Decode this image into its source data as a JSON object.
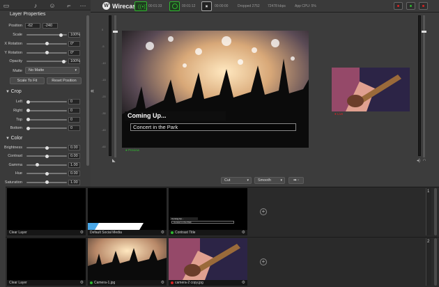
{
  "app": {
    "title": "Wirecast"
  },
  "left_panel": {
    "title": "Layer Properties",
    "tab_icons": [
      "monitor-icon",
      "speaker-icon",
      "user-icon",
      "crop-icon",
      "more-icon"
    ],
    "position": {
      "label": "Position",
      "x": "-62",
      "y": "-240"
    },
    "sliders": [
      {
        "label": "Scale",
        "value": "100%",
        "level": 0.88
      },
      {
        "label": "X Rotation",
        "value": "0°",
        "level": 0.5
      },
      {
        "label": "Y Rotation",
        "value": "0°",
        "level": 0.5
      },
      {
        "label": "Opacity",
        "value": "100%",
        "level": 0.97
      }
    ],
    "matte": {
      "label": "Matte",
      "value": "No Matte"
    },
    "buttons": {
      "scale_to_fit": "Scale To Fit",
      "reset_position": "Reset Position"
    },
    "crop": {
      "title": "Crop",
      "sliders": [
        {
          "label": "Left",
          "value": "0",
          "level": 0.0
        },
        {
          "label": "Right",
          "value": "0",
          "level": 0.0
        },
        {
          "label": "Top",
          "value": "0",
          "level": 0.0
        },
        {
          "label": "Bottom",
          "value": "0",
          "level": 0.0
        }
      ]
    },
    "color": {
      "title": "Color",
      "sliders": [
        {
          "label": "Brightness",
          "value": "0.00",
          "level": 0.5
        },
        {
          "label": "Contrast",
          "value": "0.00",
          "level": 0.5
        },
        {
          "label": "Gamma",
          "value": "1.00",
          "level": 0.25
        },
        {
          "label": "Hue",
          "value": "0.00",
          "level": 0.5
        },
        {
          "label": "Saturation",
          "value": "1.00",
          "level": 0.5
        }
      ]
    }
  },
  "topbar": {
    "stream_time": "00:01:33",
    "record_time": "00:01:12",
    "iso_time": "00:00:00",
    "dropped": "Dropped 2752",
    "bitrate": "72478 kbps",
    "cpu": "App CPU: 5%"
  },
  "preview": {
    "coming_up": "Coming Up...",
    "event_title": "Concert in the Park",
    "label": "Preview",
    "live_label": "Live"
  },
  "transition": {
    "cut": "Cut",
    "smooth": "Smooth"
  },
  "audio_meter": {
    "ticks": [
      "0",
      "-5",
      "-10",
      "-15",
      "-20",
      "-30",
      "-40",
      "-60"
    ]
  },
  "layers": [
    {
      "number": "1",
      "shots": [
        {
          "label": "Clear Layer",
          "kind": "black",
          "live": ""
        },
        {
          "label": "Default Social Media",
          "kind": "social",
          "live": ""
        },
        {
          "label": "Contrast Title",
          "kind": "title",
          "live": "#2fb82f",
          "title_line1": "Coming Up...",
          "title_line2": "Concert in the Park"
        }
      ]
    },
    {
      "number": "2",
      "shots": [
        {
          "label": "Clear Layer",
          "kind": "black",
          "live": ""
        },
        {
          "label": "Camera-1.jpg",
          "kind": "concert",
          "live": "#2fb82f"
        },
        {
          "label": "camera-2 copy.jpg",
          "kind": "guitar",
          "live": "#d62424"
        }
      ]
    }
  ],
  "colors": {
    "accent_green": "#2fb82f",
    "live_red": "#d62424",
    "brand_blue": "#4aa8e8"
  }
}
